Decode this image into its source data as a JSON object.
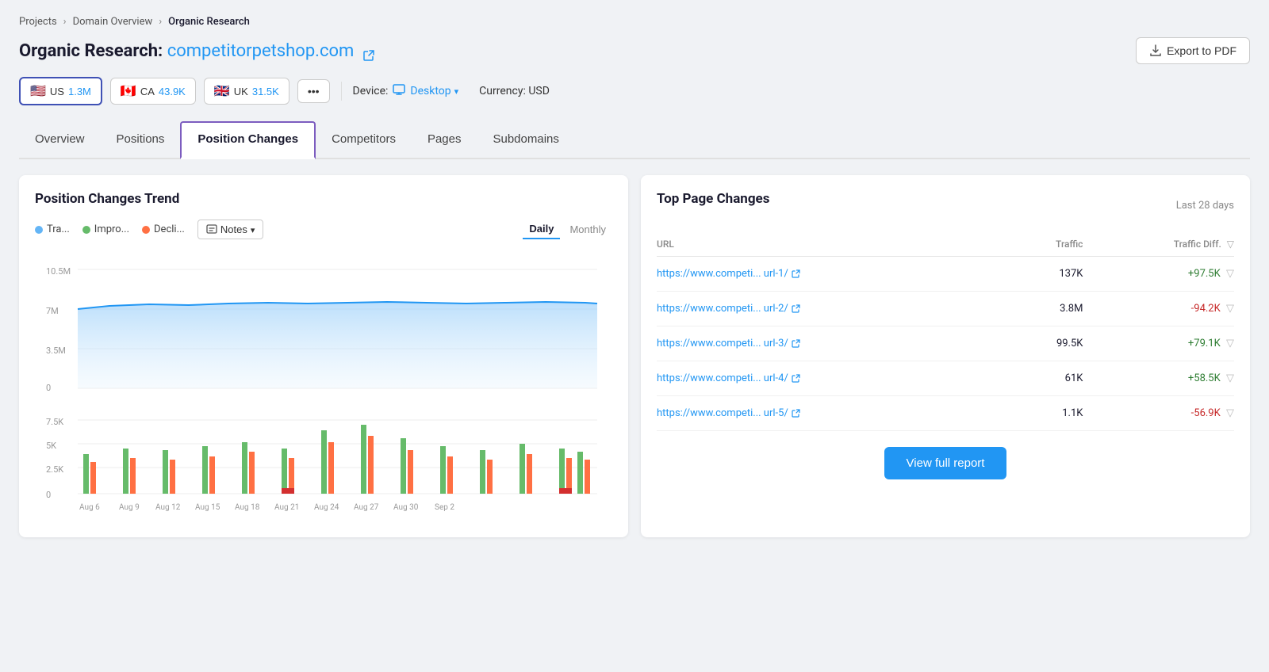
{
  "breadcrumb": {
    "items": [
      "Projects",
      "Domain Overview",
      "Organic Research"
    ]
  },
  "header": {
    "title": "Organic Research:",
    "domain": "competitorpetshop.com",
    "export_label": "Export to PDF"
  },
  "filter_bar": {
    "countries": [
      {
        "flag": "🇺🇸",
        "code": "US",
        "count": "1.3M",
        "active": true
      },
      {
        "flag": "🇨🇦",
        "code": "CA",
        "count": "43.9K",
        "active": false
      },
      {
        "flag": "🇬🇧",
        "code": "UK",
        "count": "31.5K",
        "active": false
      }
    ],
    "more_label": "•••",
    "device_label": "Device:",
    "device_value": "Desktop",
    "currency_label": "Currency: USD"
  },
  "nav": {
    "tabs": [
      "Overview",
      "Positions",
      "Position Changes",
      "Competitors",
      "Pages",
      "Subdomains"
    ],
    "active": "Position Changes"
  },
  "position_trend": {
    "title": "Position Changes Trend",
    "legend": [
      {
        "label": "Tra...",
        "color": "#64b5f6"
      },
      {
        "label": "Impro...",
        "color": "#66bb6a"
      },
      {
        "label": "Decli...",
        "color": "#ff7043"
      }
    ],
    "notes_label": "Notes",
    "view_daily": "Daily",
    "view_monthly": "Monthly",
    "active_view": "Daily",
    "x_labels": [
      "Aug 6",
      "Aug 9",
      "Aug 12",
      "Aug 15",
      "Aug 18",
      "Aug 21",
      "Aug 24",
      "Aug 27",
      "Aug 30",
      "Sep 2"
    ],
    "y_area_labels": [
      "10.5M",
      "7M",
      "3.5M",
      "0"
    ],
    "y_bar_labels": [
      "7.5K",
      "5K",
      "2.5K",
      "0"
    ]
  },
  "top_page_changes": {
    "title": "Top Page Changes",
    "period": "Last 28 days",
    "columns": {
      "url": "URL",
      "traffic": "Traffic",
      "traffic_diff": "Traffic Diff."
    },
    "rows": [
      {
        "url": "https://www.competi... url-1/",
        "traffic": "137K",
        "diff": "+97.5K",
        "positive": true
      },
      {
        "url": "https://www.competi... url-2/",
        "traffic": "3.8M",
        "diff": "-94.2K",
        "positive": false
      },
      {
        "url": "https://www.competi... url-3/",
        "traffic": "99.5K",
        "diff": "+79.1K",
        "positive": true
      },
      {
        "url": "https://www.competi... url-4/",
        "traffic": "61K",
        "diff": "+58.5K",
        "positive": true
      },
      {
        "url": "https://www.competi... url-5/",
        "traffic": "1.1K",
        "diff": "-56.9K",
        "positive": false
      }
    ],
    "view_report_label": "View full report"
  }
}
